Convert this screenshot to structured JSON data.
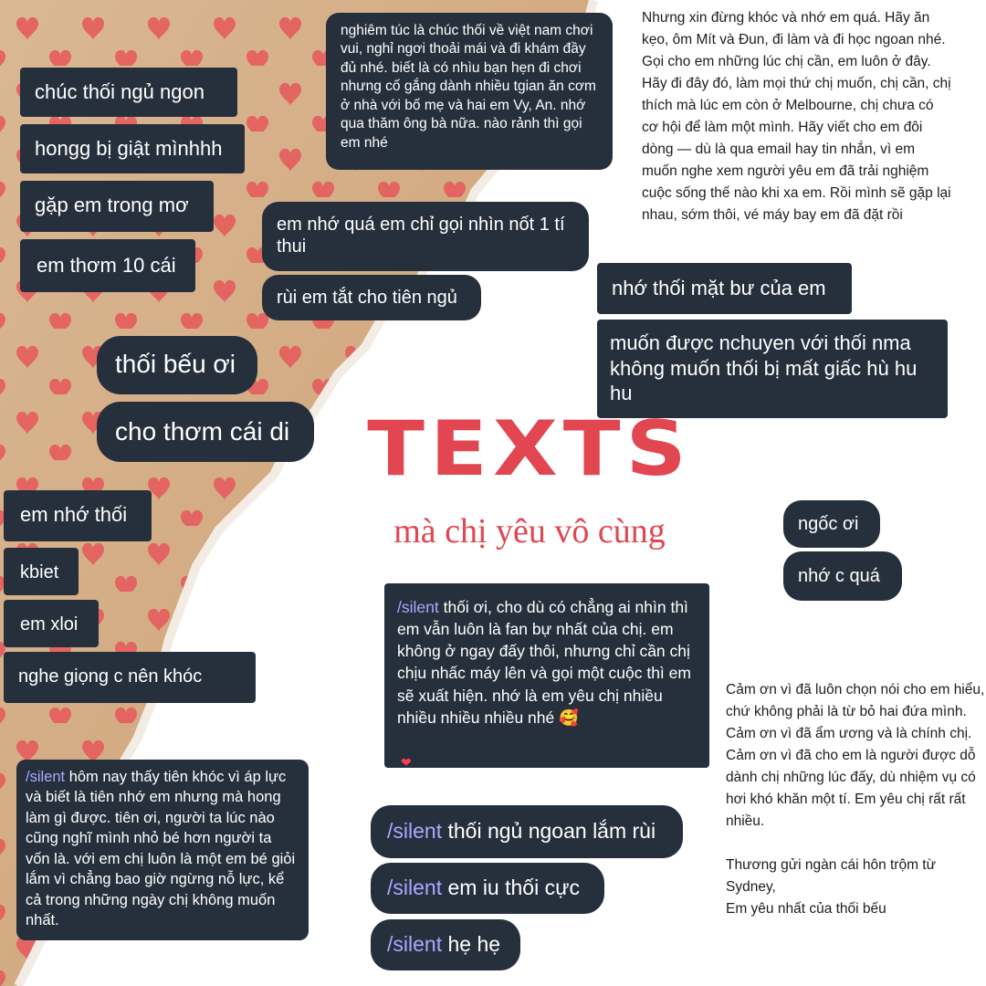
{
  "title": "TEXTS",
  "subtitle": "mà chị yêu vô cùng",
  "colors": {
    "bubble": "#26303d",
    "title": "#e24650",
    "silent": "#a9a8ff",
    "paper": "#d7b48f",
    "heart": "#e55c5c"
  },
  "left_chat": [
    "chúc thối ngủ ngon",
    "hongg bị giật mìnhhh",
    "gặp em trong mơ",
    "em thơm 10 cái"
  ],
  "mid_top_text": "nghiêm túc là chúc thối về việt nam chơi vui, nghỉ ngơi thoải mái và đi khám đầy đủ nhé. biết là có nhìu bạn hẹn đi chơi nhưng cố gắng dành nhiều tgian ăn cơm ở nhà với bố mẹ và hai em Vy, An. nhớ qua thăm ông bà nữa. nào rảnh thì gọi em nhé",
  "mid_chat": [
    "em nhớ quá em chỉ gọi nhìn nốt 1 tí thui",
    "rùi em tắt cho tiên ngủ"
  ],
  "bau_chat": [
    "thối bếu ơi",
    "cho thơm cái di"
  ],
  "right_top_note": "Nhưng xin đừng khóc và nhớ em quá. Hãy ăn kẹo, ôm Mít và Đun, đi làm và đi học ngoan nhé. Gọi cho em những lúc chị cần, em luôn ở đây. Hãy đi đây đó, làm mọi thứ chị muốn, chị cần, chị thích mà lúc em còn ở Melbourne, chị chưa có cơ hội để làm một mình. Hãy viết cho em đôi dòng — dù là qua email hay tin nhắn, vì em muốn nghe xem người yêu em đã trải nghiệm cuộc sống thế nào khi xa em. Rồi mình sẽ gặp lại nhau, sớm thôi, vé máy bay em đã đặt rồi",
  "right_chat": [
    "nhớ thối mặt bư của em",
    "muốn được nchuyen với thối nma không muốn thối bị mất giấc hù hu hu"
  ],
  "ngoc_chat": [
    "ngốc ơi",
    "nhớ c quá"
  ],
  "left_mid_chat": [
    "em nhớ thối",
    "kbiet",
    "em xloi",
    "nghe giọng c nên khóc"
  ],
  "fan_msg": {
    "silent": "/silent",
    "text": "thối ơi, cho dù có chẳng ai nhìn thì em vẫn luôn là fan bự nhất của chị. em không ở ngay đấy thôi, nhưng chỉ cần chị chịu nhấc máy lên và gọi một cuộc thì em sẽ xuất hiện. nhớ là em yêu chị nhiều nhiều nhiều nhiều nhé 🥰",
    "reaction": "❤"
  },
  "cry_msg": {
    "silent": "/silent",
    "text": "hôm nay thấy tiên khóc vì áp lực và biết là tiên nhớ em nhưng mà hong làm gì được. tiên ơi, người ta lúc nào cũng nghĩ mình nhỏ bé hơn người ta vốn là. với em chị luôn là một em bé giỏi lắm vì chẳng bao giờ ngừng nỗ lực, kể cả trong những ngày chị không muốn nhất."
  },
  "bottom_silent": [
    {
      "silent": "/silent",
      "text": "thối ngủ ngoan lắm rùi"
    },
    {
      "silent": "/silent",
      "text": "em iu thối cực"
    },
    {
      "silent": "/silent",
      "text": "hẹ hẹ"
    }
  ],
  "bottom_right_note": "Cảm ơn vì đã luôn chọn nói cho em hiểu, chứ không phải là từ bỏ hai đứa mình. Cảm ơn vì đã ẩm ương và là chính chị. Cảm ơn vì đã cho em là người được dỗ dành chị những lúc đấy, dù nhiệm vụ có hơi khó khăn một tí. Em yêu chị rất rất nhiều.\n\nThương gửi ngàn cái hôn trộm từ Sydney,\nEm yêu nhất của thối bếu"
}
